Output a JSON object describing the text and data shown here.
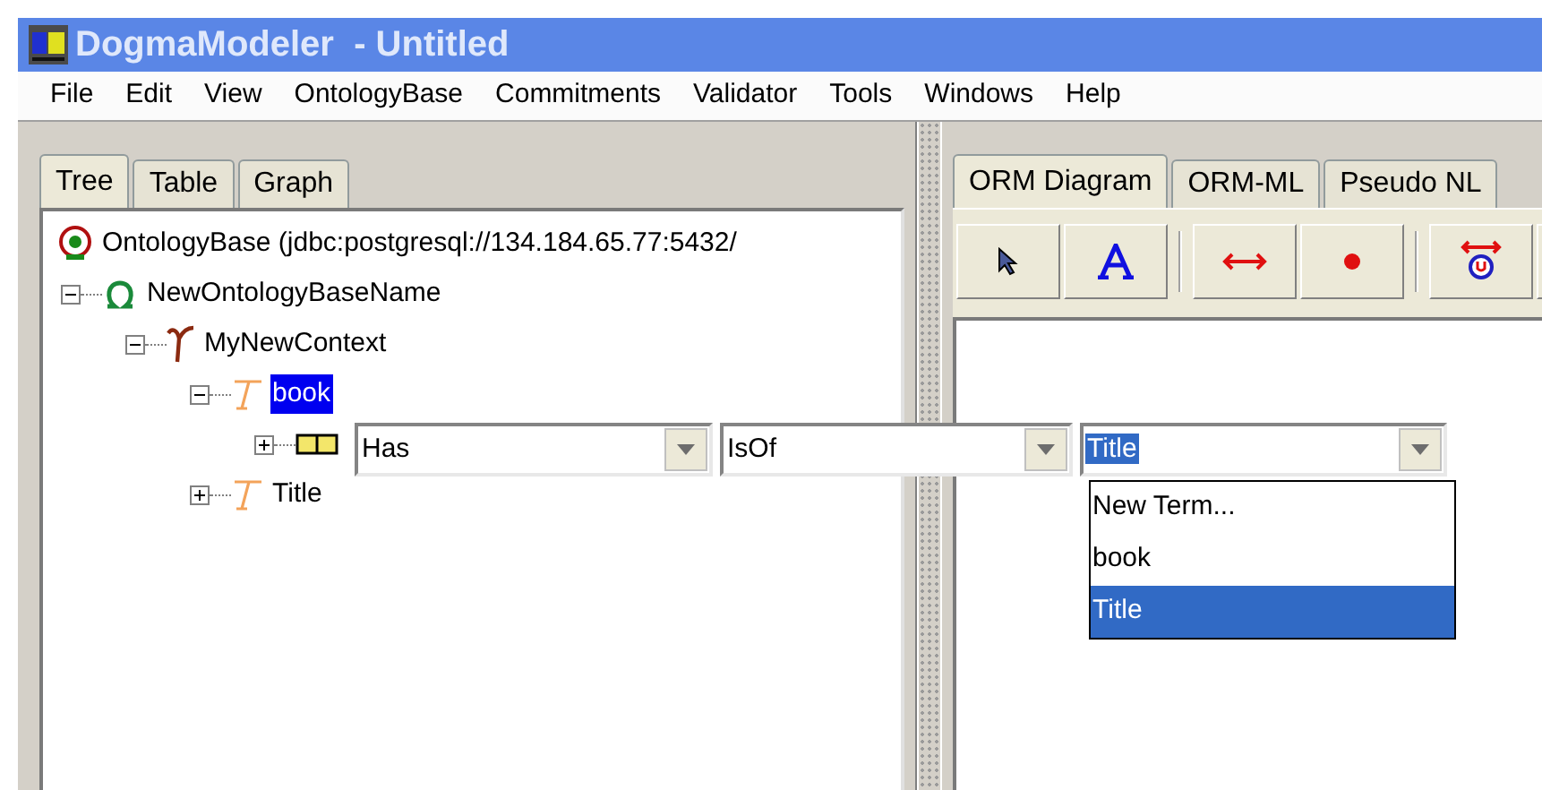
{
  "window": {
    "title": "DogmaModeler  - Untitled"
  },
  "menu": [
    {
      "label": "File"
    },
    {
      "label": "Edit"
    },
    {
      "label": "View"
    },
    {
      "label": "OntologyBase"
    },
    {
      "label": "Commitments"
    },
    {
      "label": "Validator"
    },
    {
      "label": "Tools"
    },
    {
      "label": "Windows"
    },
    {
      "label": "Help"
    }
  ],
  "left_tabs": [
    {
      "label": "Tree",
      "selected": true
    },
    {
      "label": "Table",
      "selected": false
    },
    {
      "label": "Graph",
      "selected": false
    }
  ],
  "tree": [
    {
      "kind": "ontologybase",
      "label": "OntologyBase (jdbc:postgresql://134.184.65.77:5432/",
      "children": [
        {
          "kind": "base",
          "label": "NewOntologyBaseName",
          "expanded": true,
          "children": [
            {
              "kind": "context",
              "label": "MyNewContext",
              "expanded": true,
              "children": [
                {
                  "kind": "term",
                  "label": "book",
                  "expanded": true,
                  "selected": true,
                  "children": [
                    {
                      "kind": "relation",
                      "expanded": false
                    }
                  ]
                },
                {
                  "kind": "term",
                  "label": "Title",
                  "expanded": false,
                  "selected": false
                }
              ]
            }
          ]
        }
      ]
    }
  ],
  "relation_editor": {
    "combos": [
      {
        "value": "Has",
        "highlighted": false
      },
      {
        "value": "IsOf",
        "highlighted": false
      },
      {
        "value": "Title",
        "highlighted": true
      }
    ],
    "dropdown": [
      {
        "label": "New Term...",
        "selected": false
      },
      {
        "label": "book",
        "selected": false
      },
      {
        "label": "Title",
        "selected": true
      }
    ]
  },
  "right_tabs": [
    {
      "label": "ORM Diagram",
      "selected": true
    },
    {
      "label": "ORM-ML",
      "selected": false
    },
    {
      "label": "Pseudo NL",
      "selected": false
    }
  ],
  "toolbar": [
    {
      "kind": "pointer"
    },
    {
      "kind": "text"
    },
    {
      "kind": "separator"
    },
    {
      "kind": "line"
    },
    {
      "kind": "dot"
    },
    {
      "kind": "separator"
    },
    {
      "kind": "unique"
    }
  ]
}
